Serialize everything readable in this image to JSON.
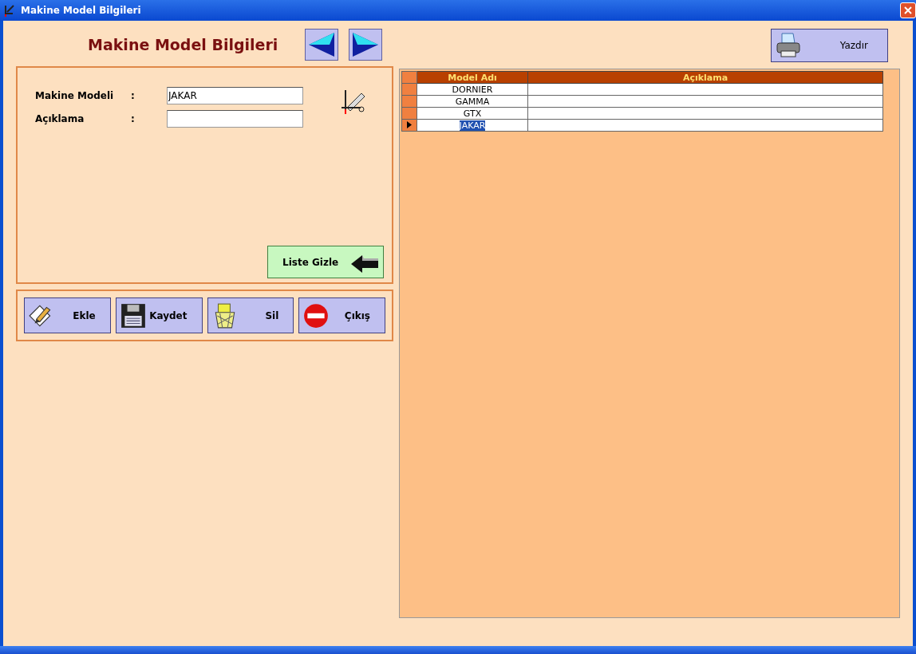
{
  "window": {
    "title": "Makine Model Bilgileri"
  },
  "header": {
    "title": "Makine Model Bilgileri"
  },
  "print_button": {
    "label": "Yazdır"
  },
  "form": {
    "fields": [
      {
        "label": "Makine Modeli",
        "separator": ":",
        "value": "JAKAR"
      },
      {
        "label": "Açıklama",
        "separator": ":"
      }
    ],
    "toggle_button": {
      "label": "Liste Gizle"
    }
  },
  "actions": [
    {
      "kind": "add",
      "label": "Ekle"
    },
    {
      "kind": "save",
      "label": "Kaydet"
    },
    {
      "kind": "delete",
      "label": "Sil"
    },
    {
      "kind": "exit",
      "label": "Çıkış"
    }
  ],
  "table": {
    "columns": [
      "Model Adı",
      "Açıklama"
    ],
    "rows": [
      {
        "model": "DORNIER",
        "selected": false
      },
      {
        "model": "GAMMA",
        "selected": false
      },
      {
        "model": "GTX",
        "selected": false
      },
      {
        "model": "JAKAR",
        "selected": true
      }
    ]
  }
}
